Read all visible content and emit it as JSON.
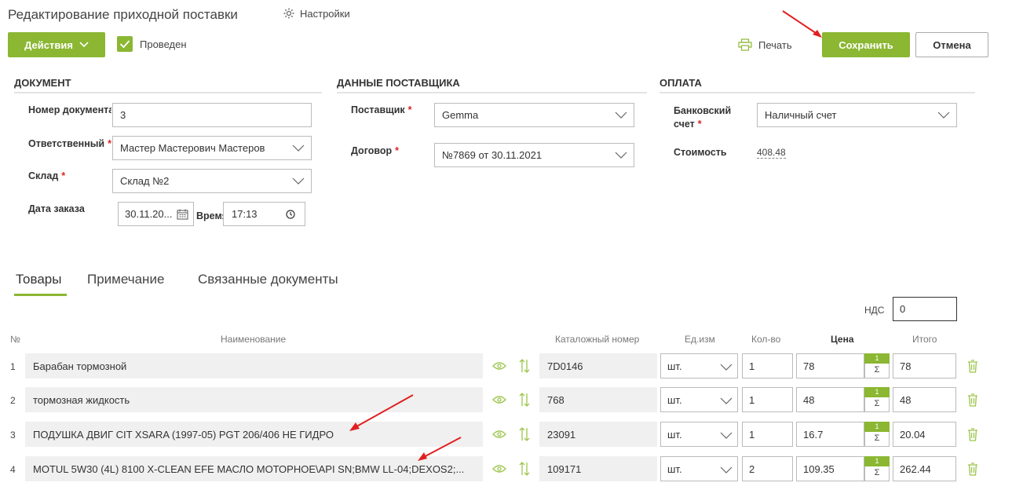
{
  "header": {
    "title": "Редактирование приходной поставки",
    "settings_label": "Настройки",
    "actions_label": "Действия",
    "posted_label": "Проведен",
    "print_label": "Печать",
    "save_label": "Сохранить",
    "cancel_label": "Отмена"
  },
  "document": {
    "section_title": "ДОКУМЕНТ",
    "number_label": "Номер документа",
    "number_value": "3",
    "responsible_label": "Ответственный",
    "responsible_value": "Мастер Мастерович Мастеров",
    "warehouse_label": "Склад",
    "warehouse_value": "Склад №2",
    "order_date_label": "Дата заказа",
    "order_date_value": "30.11.20...",
    "time_label": "Время",
    "time_value": "17:13",
    "required_mark": "*"
  },
  "supplier": {
    "section_title": "ДАННЫЕ ПОСТАВЩИКА",
    "supplier_label": "Поставщик",
    "supplier_value": "Gemma",
    "contract_label": "Договор",
    "contract_value": "№7869 от 30.11.2021"
  },
  "payment": {
    "section_title": "ОПЛАТА",
    "bank_label_1": "Банковский",
    "bank_label_2": "счет",
    "bank_value": "Наличный счет",
    "cost_label": "Стоимость",
    "cost_value": "408.48"
  },
  "tabs": [
    {
      "label": "Товары"
    },
    {
      "label": "Примечание"
    },
    {
      "label": "Связанные документы"
    }
  ],
  "vat": {
    "label": "НДС",
    "value": "0"
  },
  "table": {
    "headers": {
      "num": "№",
      "name": "Наименование",
      "catalog": "Каталожный номер",
      "unit": "Ед.изм",
      "qty": "Кол-во",
      "price": "Цена",
      "total": "Итого"
    },
    "badge_top": "1",
    "badge_bottom": "Σ",
    "rows": [
      {
        "num": "1",
        "name": "Барабан тормозной",
        "catalog": "7D0146",
        "unit": "шт.",
        "qty": "1",
        "price": "78",
        "total": "78"
      },
      {
        "num": "2",
        "name": "тормозная жидкость",
        "catalog": "768",
        "unit": "шт.",
        "qty": "1",
        "price": "48",
        "total": "48"
      },
      {
        "num": "3",
        "name": "ПОДУШКА ДВИГ CIT XSARA (1997-05) PGT 206/406 НЕ ГИДРО",
        "catalog": "23091",
        "unit": "шт.",
        "qty": "1",
        "price": "16.7",
        "total": "20.04"
      },
      {
        "num": "4",
        "name": "MOTUL 5W30 (4L) 8100 X-CLEAN EFE МАСЛО МОТОРНОЕ\\API SN;BMW LL-04;DEXOS2;...",
        "catalog": "109171",
        "unit": "шт.",
        "qty": "2",
        "price": "109.35",
        "total": "262.44"
      }
    ]
  },
  "colors": {
    "accent": "#8bb732",
    "annotation": "#e02020"
  }
}
